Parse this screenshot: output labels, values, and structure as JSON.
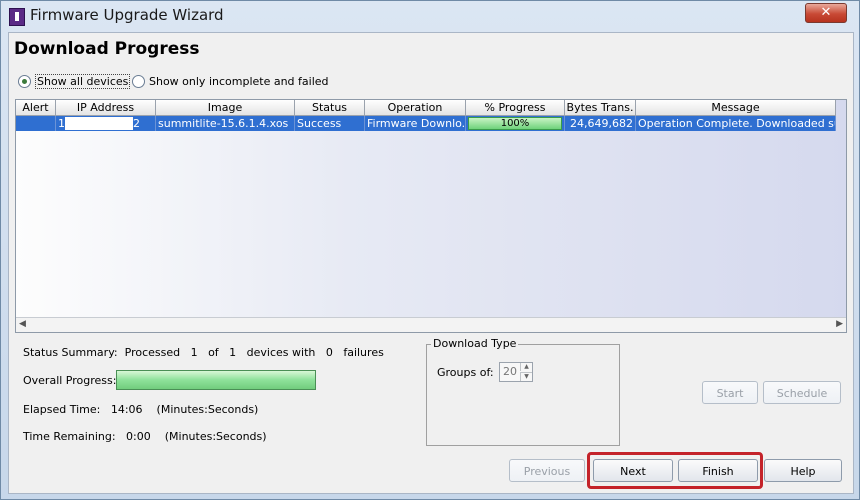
{
  "window": {
    "title": "Firmware Upgrade Wizard",
    "close_label": "✕"
  },
  "page": {
    "heading": "Download Progress"
  },
  "filter": {
    "show_all": "Show all devices",
    "show_incomplete": "Show only incomplete and failed",
    "selected": "Show all devices"
  },
  "table": {
    "columns": [
      "Alert",
      "IP Address",
      "Image",
      "Status",
      "Operation",
      "% Progress",
      "Bytes Trans.",
      "Message"
    ],
    "rows": [
      {
        "alert": "",
        "ip_prefix": "1",
        "ip_suffix": "2",
        "image": "summitlite-15.6.1.4.xos",
        "status": "Success",
        "operation": "Firmware Downlo...",
        "progress_text": "100%",
        "progress": 1.0,
        "bytes": "24,649,682",
        "message": "Operation Complete.  Downloaded sum..."
      }
    ]
  },
  "summary": {
    "status_summary_label": "Status Summary:",
    "status_summary_text": "Processed   1   of   1   devices with   0   failures",
    "overall_label": "Overall Progress:",
    "overall_progress": 1.0,
    "elapsed_label": "Elapsed Time:",
    "elapsed_value": "14:06",
    "elapsed_unit": "(Minutes:Seconds)",
    "remaining_label": "Time Remaining:",
    "remaining_value": "0:00",
    "remaining_unit": "(Minutes:Seconds)"
  },
  "download_type": {
    "legend": "Download Type",
    "groups_label": "Groups of:",
    "groups_value": "20"
  },
  "buttons": {
    "start": "Start",
    "schedule": "Schedule",
    "previous": "Previous",
    "next": "Next",
    "finish": "Finish",
    "help": "Help"
  },
  "colors": {
    "selection": "#2f6fd1",
    "highlight": "#c4232a",
    "progress_green": "#6fd27b"
  }
}
